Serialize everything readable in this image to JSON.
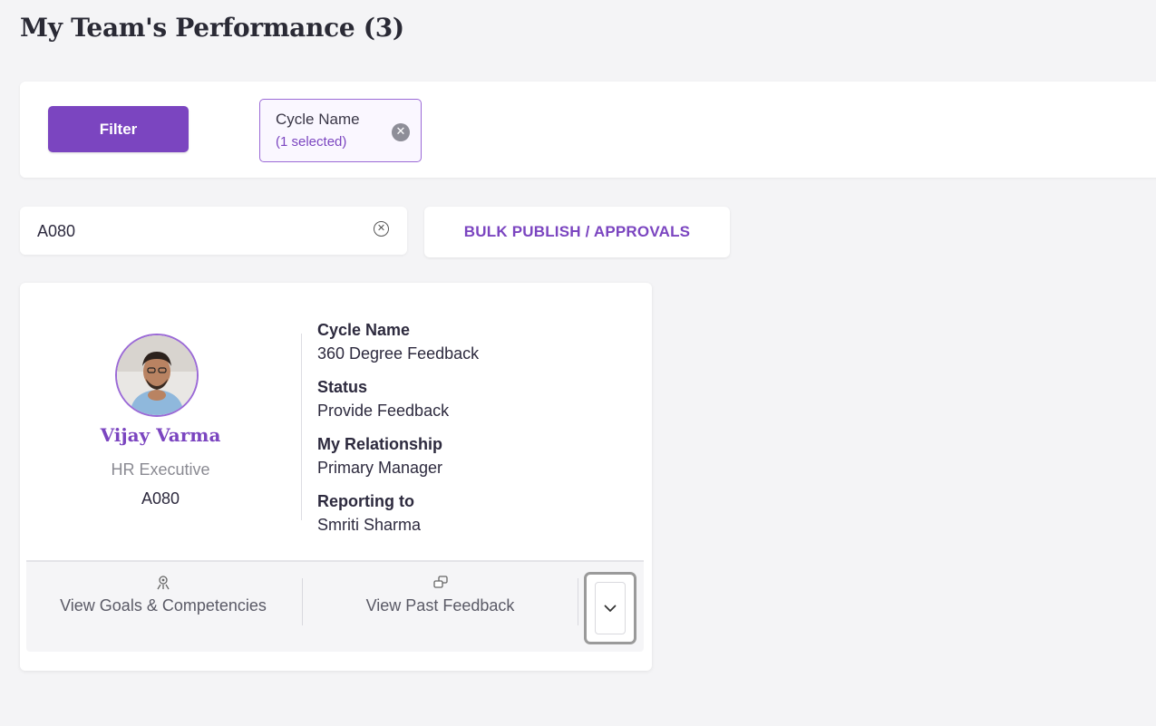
{
  "page": {
    "title": "My Team's Performance (3)"
  },
  "filter_bar": {
    "filter_label": "Filter",
    "chip": {
      "title": "Cycle Name",
      "subtitle": "(1 selected)"
    }
  },
  "search": {
    "value": "A080"
  },
  "bulk_button": {
    "label": "BULK PUBLISH / APPROVALS"
  },
  "card": {
    "employee": {
      "name": "Vijay Varma",
      "role": "HR Executive",
      "id": "A080"
    },
    "fields": [
      {
        "label": "Cycle Name",
        "value": "360 Degree Feedback"
      },
      {
        "label": "Status",
        "value": "Provide Feedback"
      },
      {
        "label": "My Relationship",
        "value": "Primary Manager"
      },
      {
        "label": "Reporting to",
        "value": "Smriti Sharma"
      }
    ],
    "actions": [
      {
        "label": "View Goals & Competencies",
        "icon": "goals-icon"
      },
      {
        "label": "View Past Feedback",
        "icon": "feedback-icon"
      }
    ],
    "expand_icon": "chevron-down-icon"
  },
  "colors": {
    "accent": "#7b45c0",
    "background": "#f4f4f6"
  }
}
